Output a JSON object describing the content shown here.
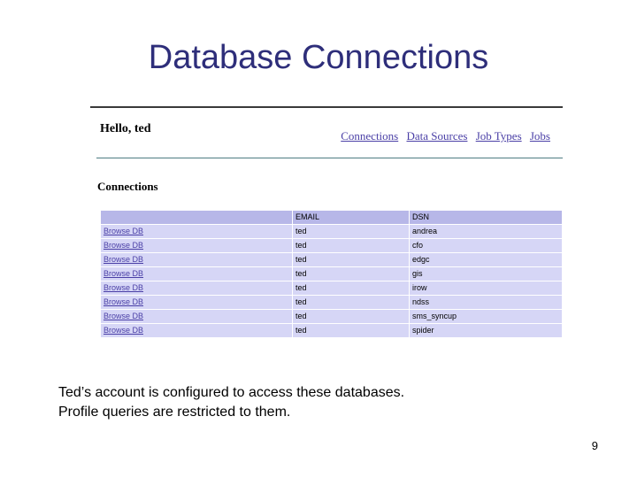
{
  "slide": {
    "title": "Database Connections",
    "caption_lines": [
      "Ted’s account is configured to access these databases.",
      "Profile queries are restricted to them."
    ],
    "page_number": "9"
  },
  "app": {
    "greeting": "Hello, ted",
    "nav": [
      {
        "label": "Connections"
      },
      {
        "label": "Data Sources"
      },
      {
        "label": "Job Types"
      },
      {
        "label": "Jobs"
      }
    ],
    "section_heading": "Connections",
    "table": {
      "headers": [
        "",
        "EMAIL",
        "DSN"
      ],
      "rows": [
        {
          "action": "Browse DB",
          "email": "ted",
          "dsn": "andrea"
        },
        {
          "action": "Browse DB",
          "email": "ted",
          "dsn": "cfo"
        },
        {
          "action": "Browse DB",
          "email": "ted",
          "dsn": "edgc"
        },
        {
          "action": "Browse DB",
          "email": "ted",
          "dsn": "gis"
        },
        {
          "action": "Browse DB",
          "email": "ted",
          "dsn": "irow"
        },
        {
          "action": "Browse DB",
          "email": "ted",
          "dsn": "ndss"
        },
        {
          "action": "Browse DB",
          "email": "ted",
          "dsn": "sms_syncup"
        },
        {
          "action": "Browse DB",
          "email": "ted",
          "dsn": "spider"
        }
      ]
    }
  },
  "colors": {
    "title": "#2e2e7a",
    "link": "#4a3fa6",
    "header_bg": "#b7b7e8",
    "row_bg": "#d6d6f6"
  }
}
